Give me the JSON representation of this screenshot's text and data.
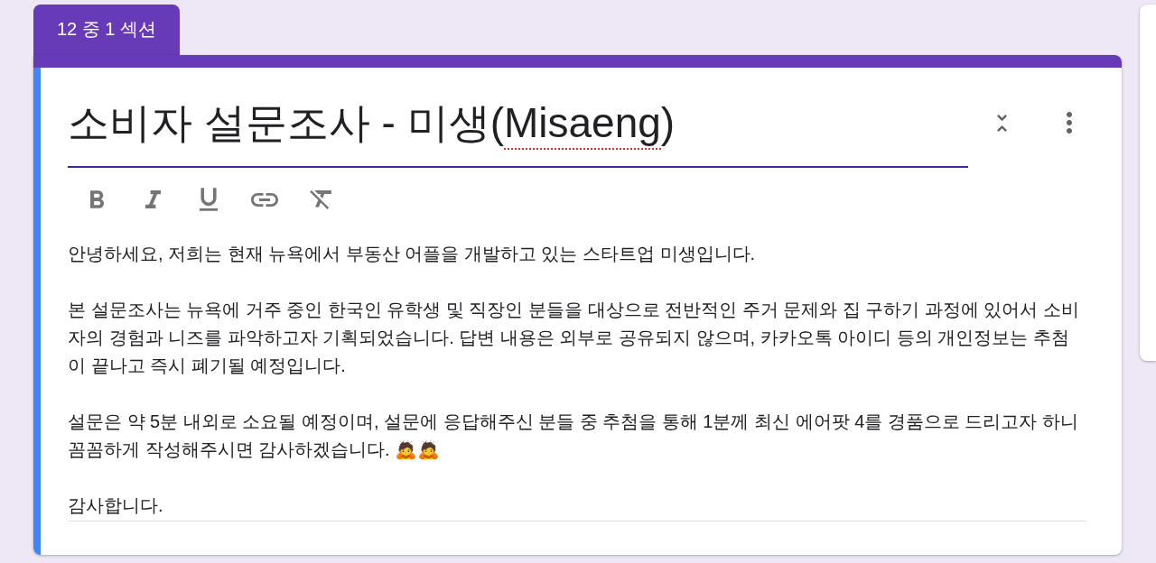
{
  "section_tab": {
    "label": "12 중 1 섹션"
  },
  "title_field": {
    "focused": true,
    "segments": [
      {
        "text": "소비자 설문조사 - 미생(",
        "misspelled": false
      },
      {
        "text": "Misaeng",
        "misspelled": true
      },
      {
        "text": ")",
        "misspelled": false
      }
    ]
  },
  "description_field": {
    "paragraphs": [
      {
        "text": "안녕하세요, 저희는 현재 뉴욕에서 부동산 어플을 개발하고 있는 스타트업 미생입니다."
      },
      {
        "text": "본 설문조사는 뉴욕에 거주 중인 한국인 유학생 및 직장인 분들을 대상으로 전반적인 주거 문제와 집 구하기 과정에 있어서 소비자의 경험과 니즈를 파악하고자 기획되었습니다. 답변 내용은 외부로 공유되지 않으며, 카카오톡 아이디 등의 개인정보는 추첨이 끝나고 즉시 폐기될 예정입니다."
      },
      {
        "text": "설문은 약 5분 내외로 소요될 예정이며, 설문에 응답해주신 분들 중 추첨을 통해 1분께 최신 에어팟 4를 경품으로 드리고자 하니 꼼꼼하게 작성해주시면 감사하겠습니다. 🙇🙇"
      },
      {
        "text": "감사합니다."
      }
    ]
  }
}
